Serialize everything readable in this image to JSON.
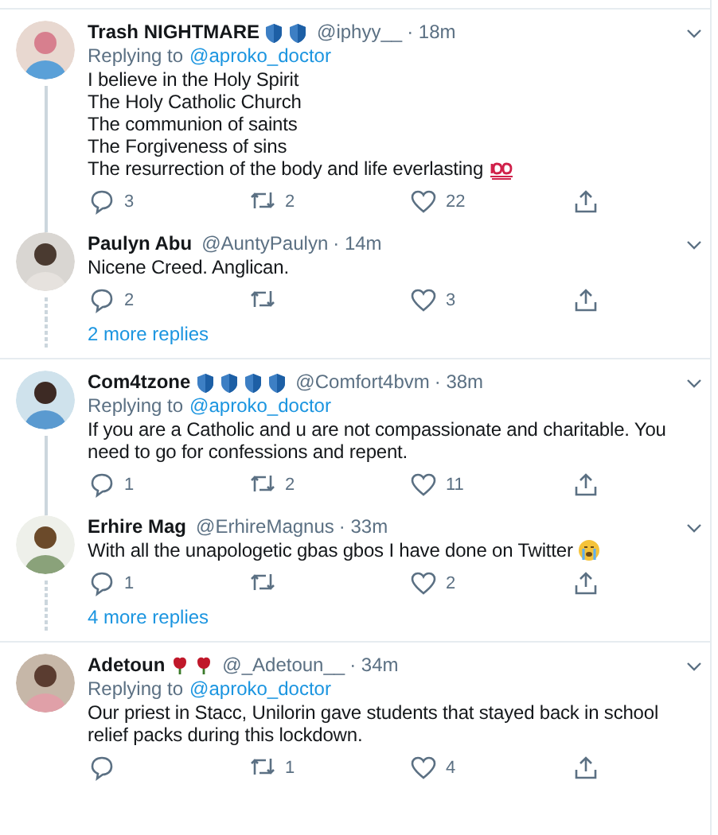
{
  "threads": [
    {
      "tweets": [
        {
          "name": "Trash NIGHTMARE",
          "badges": [
            {
              "kind": "shield"
            },
            {
              "kind": "shield"
            }
          ],
          "handle": "@iphyy__",
          "time": "· 18m",
          "replying_to": {
            "label": "Replying to",
            "user": "@aproko_doctor"
          },
          "lines": [
            "I believe in the Holy Spirit",
            "The Holy Catholic Church",
            "The communion of saints",
            "The Forgiveness of sins",
            "The resurrection of the body and life everlasting"
          ],
          "end_emoji": {
            "kind": "hundred"
          },
          "replies": "3",
          "retweets": "2",
          "likes": "22"
        },
        {
          "name": "Paulyn Abu",
          "handle": "@AuntyPaulyn",
          "time": "· 14m",
          "lines": [
            "Nicene Creed. Anglican."
          ],
          "replies": "2",
          "likes": "3"
        }
      ],
      "more_replies": "2 more replies"
    },
    {
      "tweets": [
        {
          "name": "Com4tzone",
          "badges": [
            {
              "kind": "shield"
            },
            {
              "kind": "shield"
            },
            {
              "kind": "shield"
            },
            {
              "kind": "shield"
            }
          ],
          "handle": "@Comfort4bvm",
          "time": "· 38m",
          "replying_to": {
            "label": "Replying to",
            "user": "@aproko_doctor"
          },
          "lines": [
            "If you are a Catholic and u are not compassionate and charitable. You need to go for confessions and repent."
          ],
          "replies": "1",
          "retweets": "2",
          "likes": "11"
        },
        {
          "name": "Erhire Mag",
          "handle": "@ErhireMagnus",
          "time": "· 33m",
          "lines": [
            "With all the unapologetic gbas gbos I have done on Twitter"
          ],
          "end_emoji": {
            "kind": "crying"
          },
          "replies": "1",
          "likes": "2"
        }
      ],
      "more_replies": "4 more replies"
    },
    {
      "tweets": [
        {
          "name": "Adetoun",
          "badges": [
            {
              "kind": "rose"
            },
            {
              "kind": "rose"
            }
          ],
          "handle": "@_Adetoun__",
          "time": "· 34m",
          "replying_to": {
            "label": "Replying to",
            "user": "@aproko_doctor"
          },
          "lines": [
            "Our priest in Stacc, Unilorin gave students that stayed back in school relief packs during this lockdown."
          ],
          "retweets": "1",
          "likes": "4"
        }
      ]
    }
  ]
}
